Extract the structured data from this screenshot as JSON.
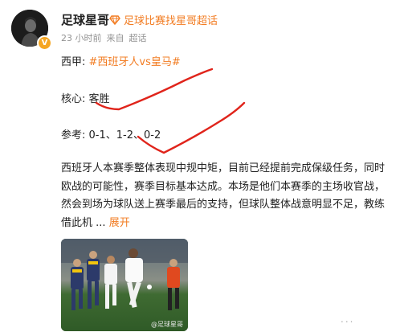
{
  "user": {
    "name": "足球星哥",
    "badge": "足球比赛找星哥超话",
    "time": "23 小时前",
    "source": "来自",
    "source_name": "超话"
  },
  "post": {
    "line1_prefix": "西甲:",
    "line1_tag": "#西班牙人vs皇马#",
    "line2": "核心: 客胜",
    "line3": "参考: 0-1、1-2、0-2",
    "para_lines": [
      "西班牙人本赛季整体表现中规中矩，目前已经提前完成保级任务，同时",
      "欧战的可能性，赛季目标基本达成。本场是他们本赛季的主场收官战，",
      "然会到场为球队送上赛季最后的支持，但球队整体战意明显不足，教练",
      "借此机"
    ],
    "ellipsis": "...",
    "expand": "展开",
    "image_watermark": "@足球星哥",
    "more": "..."
  },
  "colors": {
    "accent": "#f27c22",
    "meta": "#939393",
    "scribble": "#e0241b"
  }
}
